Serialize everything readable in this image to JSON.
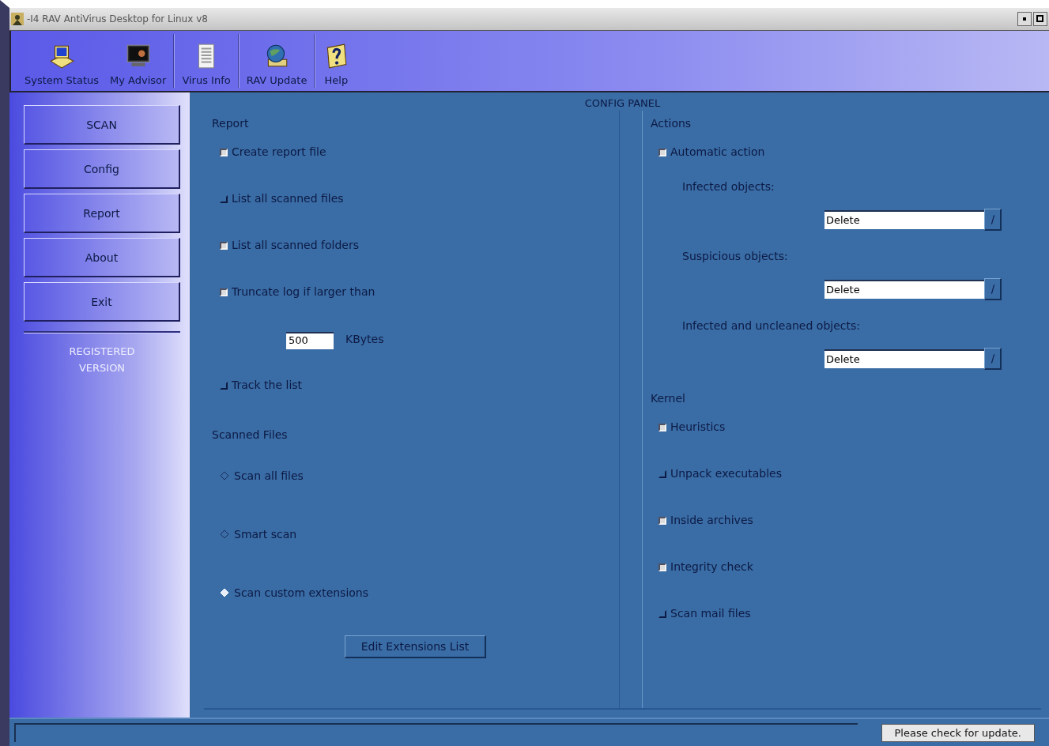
{
  "window": {
    "title": "-I4 RAV AntiVirus Desktop for Linux v8"
  },
  "toolbar": [
    {
      "label": "System Status",
      "kind": "monitor"
    },
    {
      "label": "My Advisor",
      "kind": "advisor"
    },
    {
      "label": "Virus Info",
      "kind": "document"
    },
    {
      "label": "RAV Update",
      "kind": "globe"
    },
    {
      "label": "Help",
      "kind": "help"
    }
  ],
  "sidebar": {
    "buttons": [
      {
        "label": "SCAN"
      },
      {
        "label": "Config"
      },
      {
        "label": "Report"
      },
      {
        "label": "About"
      },
      {
        "label": "Exit"
      }
    ],
    "registered": "REGISTERED VERSION"
  },
  "panel_title": "CONFIG PANEL",
  "report": {
    "title": "Report",
    "items": [
      {
        "kind": "checkbox",
        "label": "Create report file",
        "checked": true
      },
      {
        "kind": "checkbox",
        "label": "List all scanned files",
        "checked": false
      },
      {
        "kind": "checkbox",
        "label": "List all scanned folders",
        "checked": true
      },
      {
        "kind": "checkbox",
        "label": "Truncate log if larger than",
        "checked": true
      },
      {
        "kind": "size",
        "value": "500",
        "unit": "KBytes"
      },
      {
        "kind": "checkbox",
        "label": "Track the list",
        "checked": false
      }
    ]
  },
  "scanned_files": {
    "title": "Scanned Files",
    "options": [
      {
        "label": "Scan all files",
        "selected": false
      },
      {
        "label": "Smart scan",
        "selected": false
      },
      {
        "label": "Scan custom extensions",
        "selected": true
      }
    ],
    "button": "Edit Extensions List"
  },
  "actions": {
    "title": "Actions",
    "automatic": {
      "label": "Automatic action",
      "checked": true
    },
    "selects": [
      {
        "label": "Infected objects:",
        "value": "Delete"
      },
      {
        "label": "Suspicious objects:",
        "value": "Delete"
      },
      {
        "label": "Infected and uncleaned objects:",
        "value": "Delete"
      }
    ]
  },
  "kernel": {
    "title": "Kernel",
    "options": [
      {
        "label": "Heuristics",
        "checked": true
      },
      {
        "label": "Unpack executables",
        "checked": false
      },
      {
        "label": "Inside archives",
        "checked": true
      },
      {
        "label": "Integrity check",
        "checked": true
      },
      {
        "label": "Scan mail files",
        "checked": false
      }
    ]
  },
  "status_bar": {
    "message": "Please check for update."
  }
}
